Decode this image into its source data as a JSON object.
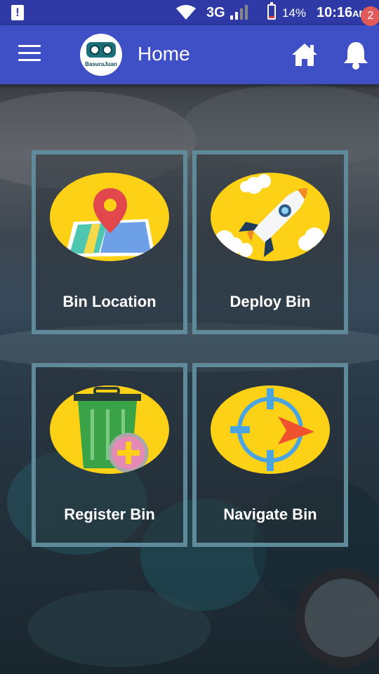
{
  "status_bar": {
    "network": "3G",
    "battery_text": "14%",
    "battery_level": 0.14,
    "time": "10:16",
    "ampm": "AM"
  },
  "app_bar": {
    "title": "Home",
    "logo_text": "BasuraJuan",
    "notification_count": "2",
    "accent": "#3f4fc6"
  },
  "tiles": [
    {
      "label": "Bin Location",
      "icon": "map-pin-icon"
    },
    {
      "label": "Deploy Bin",
      "icon": "rocket-icon"
    },
    {
      "label": "Register Bin",
      "icon": "trash-bin-add-icon"
    },
    {
      "label": "Navigate Bin",
      "icon": "navigation-target-icon"
    }
  ],
  "colors": {
    "tile_circle": "#fcd116",
    "tile_border": "#5f8a99",
    "status_bar": "#2f3aa6"
  }
}
